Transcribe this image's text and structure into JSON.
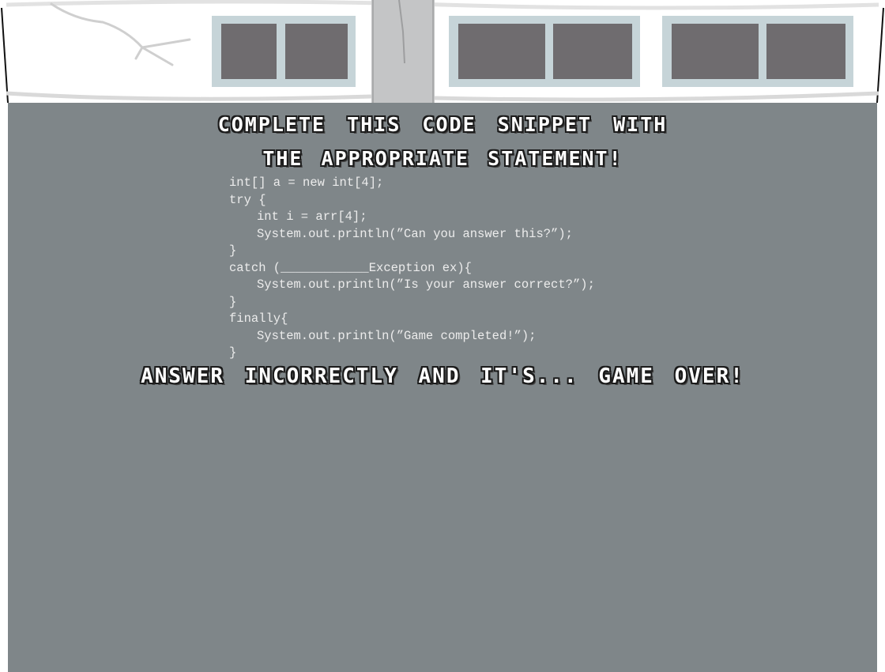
{
  "quiz": {
    "title_line_1": "Complete this code snippet with",
    "title_line_2": "the appropriate statement!",
    "warning": "Answer incorrectly and it's... game over!"
  },
  "code_snippet": {
    "lines": [
      "int[] a = new int[4];",
      "try {",
      "int i = arr[4];",
      "System.out.println(”Can you answer this?”);",
      "}",
      "catch (____________Exception ex){",
      "System.out.println(”Is your answer correct?”);",
      "}",
      "finally{",
      "System.out.println(”Game completed!”);",
      "}"
    ]
  },
  "colors": {
    "board": "#7f8689",
    "wall": "#ffffff",
    "window_glass": "#6f6c6f",
    "window_frame": "#c6d4d8",
    "column": "#c4c5c6",
    "title_text": "#ffffff",
    "title_outline": "#1b1b1b",
    "code_text": "#ececec"
  }
}
